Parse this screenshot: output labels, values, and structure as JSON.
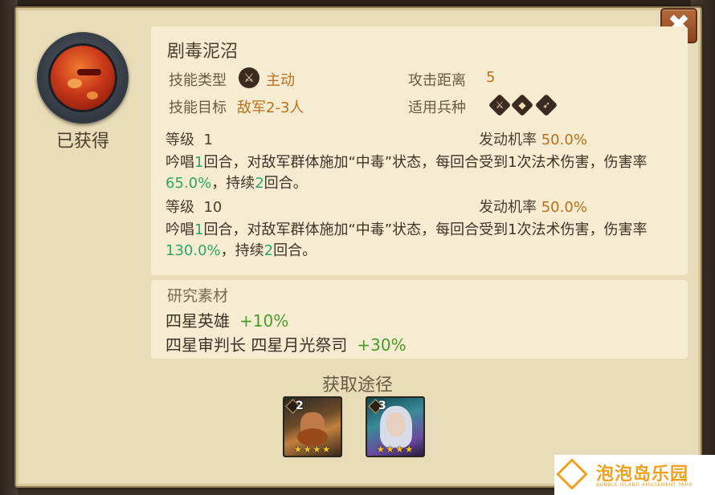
{
  "skill": {
    "name": "剧毒泥沼",
    "obtained_label": "已获得",
    "type_label": "技能类型",
    "type_value": "主动",
    "range_label": "攻击距离",
    "range_value": "5",
    "target_label": "技能目标",
    "target_value": "敌军2-3人",
    "troop_label": "适用兵种",
    "troop_icons": [
      "sword-troop-icon",
      "shield-troop-icon",
      "bow-troop-icon"
    ]
  },
  "levels": [
    {
      "level_label": "等级",
      "level": "1",
      "rate_label": "发动机率",
      "rate": "50.0%",
      "desc_a": "吟唱",
      "desc_n1": "1",
      "desc_b": "回合，对敌军群体施加“中毒”状态，每回合受到1次法术伤害，伤害率",
      "desc_pct": "65.0%",
      "desc_c": "，持续",
      "desc_n2": "2",
      "desc_d": "回合。"
    },
    {
      "level_label": "等级",
      "level": "10",
      "rate_label": "发动机率",
      "rate": "50.0%",
      "desc_a": "吟唱",
      "desc_n1": "1",
      "desc_b": "回合，对敌军群体施加“中毒”状态，每回合受到1次法术伤害，伤害率",
      "desc_pct": "130.0%",
      "desc_c": "，持续",
      "desc_n2": "2",
      "desc_d": "回合。"
    }
  ],
  "research": {
    "title": "研究素材",
    "items": [
      {
        "name": "四星英雄",
        "bonus": "+10%"
      },
      {
        "name": "四星审判长 四星月光祭司",
        "bonus": "+30%"
      }
    ]
  },
  "obtain": {
    "title": "获取途径",
    "heroes": [
      {
        "level": "2",
        "stars": "★★★★",
        "portrait": "dwarf-hero-portrait"
      },
      {
        "level": "3",
        "stars": "★★★★",
        "portrait": "elf-priestess-portrait"
      }
    ]
  },
  "close_label": "✖",
  "watermark": {
    "cn": "泡泡岛乐园",
    "en": "BUBBLE ISLAND AMUSEMENT PARK"
  }
}
